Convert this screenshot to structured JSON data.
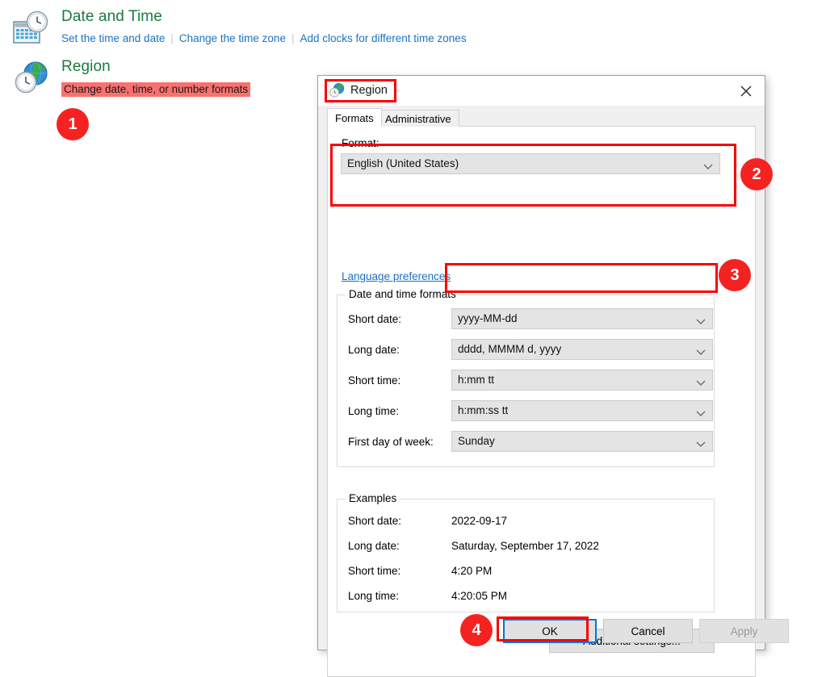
{
  "control_panel": {
    "sections": [
      {
        "icon": "calendar-clock-icon",
        "heading": "Date and Time",
        "links": [
          "Set the time and date",
          "Change the time zone",
          "Add clocks for different time zones"
        ]
      },
      {
        "icon": "globe-clock-icon",
        "heading": "Region",
        "links": [
          "Change date, time, or number formats"
        ]
      }
    ]
  },
  "badges": [
    {
      "number": "1"
    },
    {
      "number": "2"
    },
    {
      "number": "3"
    },
    {
      "number": "4"
    }
  ],
  "dialog": {
    "title": "Region",
    "title_icon": "globe-clock-icon",
    "close_icon": "close-icon",
    "tabs": [
      {
        "label": "Formats",
        "active": true
      },
      {
        "label": "Administrative",
        "active": false
      }
    ],
    "format": {
      "label": "Format:",
      "value": "English (United States)",
      "chevron_icon": "chevron-down-icon"
    },
    "language_preferences_link": "Language preferences",
    "date_time_formats": {
      "legend": "Date and time formats",
      "rows": [
        {
          "label": "Short date:",
          "value": "yyyy-MM-dd"
        },
        {
          "label": "Long date:",
          "value": "dddd, MMMM d, yyyy"
        },
        {
          "label": "Short time:",
          "value": "h:mm tt"
        },
        {
          "label": "Long time:",
          "value": "h:mm:ss tt"
        },
        {
          "label": "First day of week:",
          "value": "Sunday"
        }
      ]
    },
    "examples": {
      "legend": "Examples",
      "rows": [
        {
          "label": "Short date:",
          "value": "2022-09-17"
        },
        {
          "label": "Long date:",
          "value": "Saturday, September 17, 2022"
        },
        {
          "label": "Short time:",
          "value": "4:20 PM"
        },
        {
          "label": "Long time:",
          "value": "4:20:05 PM"
        }
      ]
    },
    "additional_settings_button": "Additional settings...",
    "buttons": {
      "ok": "OK",
      "cancel": "Cancel",
      "apply": "Apply"
    }
  },
  "colors": {
    "heading_green": "#1b7a3d",
    "link_blue": "#1b72c4",
    "annotation_red": "#fa0000",
    "badge_red": "#f52222",
    "highlight_salmon": "#f9716f",
    "focus_blue": "#0078d7"
  }
}
